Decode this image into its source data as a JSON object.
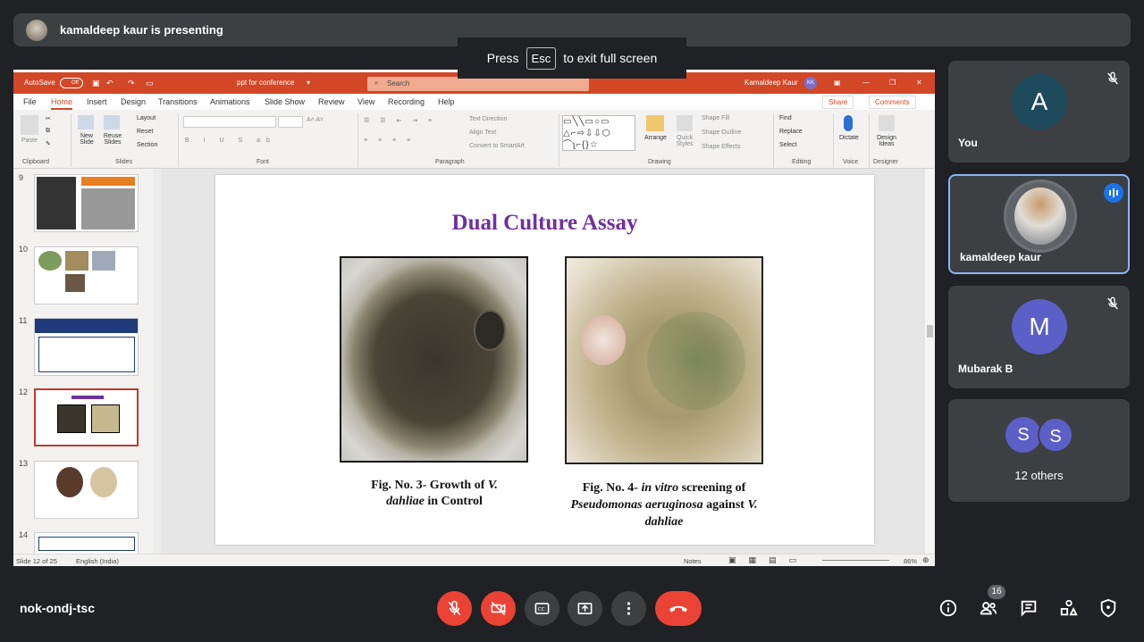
{
  "meet": {
    "presenting": "kamaldeep kaur is presenting",
    "esc_press": "Press",
    "esc_key": "Esc",
    "esc_rest": "to exit full screen",
    "meeting_code": "nok-ondj-tsc",
    "people_count": "16"
  },
  "participants": {
    "you": {
      "initial": "A",
      "name": "You"
    },
    "presenter": {
      "name": "kamaldeep kaur"
    },
    "mubarak": {
      "initial": "M",
      "name": "Mubarak B"
    },
    "others": {
      "initial1": "S",
      "initial2": "S",
      "label": "12 others"
    }
  },
  "ppt": {
    "autosave": "AutoSave",
    "autosave_state": "Off",
    "doc_title": "ppt for conference",
    "search_placeholder": "Search",
    "user_name": "Kamaldeep Kaur",
    "user_initials": "KK",
    "menu": [
      "File",
      "Home",
      "Insert",
      "Design",
      "Transitions",
      "Animations",
      "Slide Show",
      "Review",
      "View",
      "Recording",
      "Help"
    ],
    "share": "Share",
    "comments": "Comments",
    "ribbon": {
      "paste": "Paste",
      "new_slide": "New Slide",
      "reuse_slides": "Reuse Slides",
      "layout": "Layout",
      "reset": "Reset",
      "section": "Section",
      "text_direction": "Text Direction",
      "align_text": "Align Text",
      "convert_smartart": "Convert to SmartArt",
      "arrange": "Arrange",
      "quick_styles": "Quick Styles",
      "shape_fill": "Shape Fill",
      "shape_outline": "Shape Outline",
      "shape_effects": "Shape Effects",
      "find": "Find",
      "replace": "Replace",
      "select": "Select",
      "dictate": "Dictate",
      "design_ideas": "Design Ideas",
      "groups": [
        "Clipboard",
        "Slides",
        "Font",
        "Paragraph",
        "Drawing",
        "Editing",
        "Voice",
        "Designer"
      ]
    },
    "thumbs": [
      "9",
      "10",
      "11",
      "12",
      "13",
      "14"
    ],
    "slide": {
      "title": "Dual Culture Assay",
      "cap_left_1": "Fig. No. 3- Growth of ",
      "cap_left_v": "V.",
      "cap_left_2": "dahliae",
      "cap_left_3": " in Control",
      "cap_right_1": "Fig. No. 4- ",
      "cap_right_iv": "in vitro",
      "cap_right_2": " screening of",
      "cap_right_pa": "Pseudomonas aeruginosa",
      "cap_right_3": " against ",
      "cap_right_v": "V.",
      "cap_right_d": "dahliae"
    },
    "status": {
      "slide_count": "Slide 12 of 25",
      "language": "English (India)",
      "notes": "Notes",
      "zoom": "86%"
    }
  }
}
